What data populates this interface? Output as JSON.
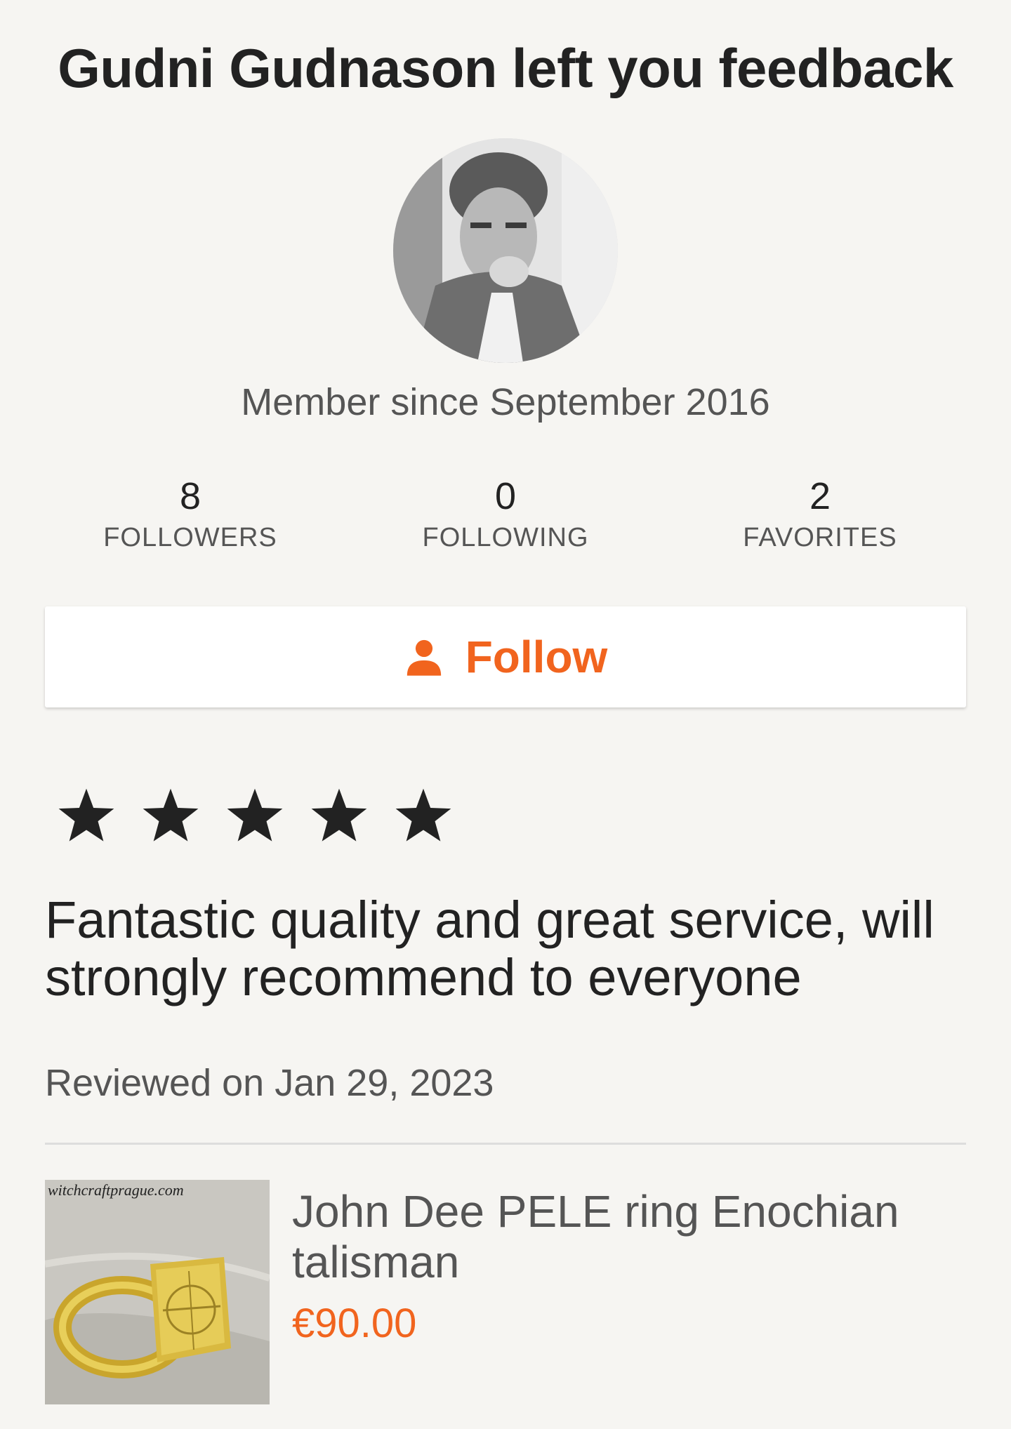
{
  "header": {
    "title": "Gudni Gudnason left you feedback"
  },
  "profile": {
    "avatar_alt": "Gudni Gudnason",
    "member_since": "Member since September 2016"
  },
  "stats": [
    {
      "value": "8",
      "label": "FOLLOWERS"
    },
    {
      "value": "0",
      "label": "FOLLOWING"
    },
    {
      "value": "2",
      "label": "FAVORITES"
    }
  ],
  "follow_button": {
    "label": "Follow",
    "icon": "person-icon"
  },
  "review": {
    "rating": 5,
    "rating_max": 5,
    "text": "Fantastic quality and great service, will strongly recommend to everyone",
    "date": "Reviewed on Jan 29, 2023"
  },
  "listing": {
    "image_watermark": "witchcraftprague.com",
    "title": "John Dee PELE ring Enochian talisman",
    "price": "€90.00"
  },
  "colors": {
    "accent": "#f1641e",
    "text_primary": "#222222",
    "text_secondary": "#555555",
    "background": "#f6f5f2"
  }
}
